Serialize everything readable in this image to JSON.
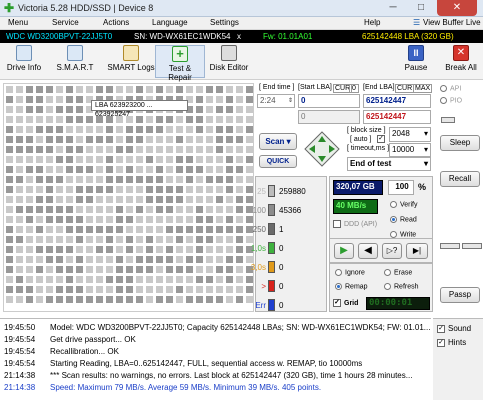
{
  "window": {
    "title": "Victoria 5.28 HDD/SSD | Device 8",
    "min": "─",
    "max": "□",
    "close": "✕"
  },
  "menu": {
    "items": [
      "Menu",
      "Service",
      "Actions",
      "Language",
      "Settings",
      "Help"
    ],
    "view_buffer": "View Buffer Live"
  },
  "device": {
    "model": "WDC WD3200BPVT-22JJ5T0",
    "serial": "SN: WD-WX61EC1WDK54",
    "x": "x",
    "firmware": "Fw: 01.01A01",
    "capacity": "625142448 LBA (320 GB)"
  },
  "toolbar": {
    "drive_info": "Drive Info",
    "smart": "S.M.A.R.T",
    "smart_logs": "SMART Logs",
    "test_repair": "Test & Repair",
    "disk_editor": "Disk Editor",
    "pause": "Pause",
    "break_all": "Break All"
  },
  "grid": {
    "tooltip": "LBA 623923200 ... 623925247"
  },
  "range": {
    "end_time_label": "[ End time ]",
    "start_lba_label": "[Start LBA]",
    "cur_label": "CUR",
    "zero_label": "0",
    "end_lba_label": "[End LBA]",
    "cur2_label": "CUR",
    "max_label": "MAX",
    "end_time": "2:24",
    "start_lba": "0",
    "end_lba": "625142447",
    "start_lba2": "0",
    "end_lba2": "625142447"
  },
  "scan": {
    "scan_button": "Scan",
    "quick_button": "QUICK",
    "block_size_label": "[ block size ]",
    "auto_label": "[ auto ]",
    "block_size": "2048",
    "timeout_label": "[ timeout,ms ]",
    "timeout": "10000",
    "end_mode": "End of test"
  },
  "legend": {
    "rows": [
      {
        "threshold": "25",
        "count": "259880",
        "color": "#bcbcbc"
      },
      {
        "threshold": "100",
        "count": "45366",
        "color": "#8c8c8c"
      },
      {
        "threshold": "250",
        "count": "1",
        "color": "#6a6a6a"
      },
      {
        "threshold": "1,0s",
        "count": "0",
        "color": "#3fb23f"
      },
      {
        "threshold": "3,0s",
        "count": "0",
        "color": "#e09a1a"
      },
      {
        "threshold": ">",
        "count": "0",
        "color": "#d8231c"
      },
      {
        "threshold": "Err",
        "count": "0",
        "color": "#1f3fcf"
      }
    ]
  },
  "stats": {
    "size": "320,07 GB",
    "percent": "100",
    "percent_unit": "%",
    "speed": "40 MB/s",
    "ddd": "DDD (API)",
    "verify": "Verify",
    "read": "Read",
    "write": "Write"
  },
  "actions": {
    "ignore": "Ignore",
    "erase": "Erase",
    "remap": "Remap",
    "refresh": "Refresh",
    "grid": "Grid",
    "timer": "00:00:01"
  },
  "side": {
    "api": "API",
    "pio": "PIO",
    "sleep": "Sleep",
    "recall": "Recall",
    "passp": "Passp"
  },
  "log": {
    "rows": [
      {
        "time": "19:45:50",
        "text": "Model: WDC WD3200BPVT-22JJ5T0; Capacity 625142448 LBAs; SN: WD-WX61EC1WDK54; FW: 01.01...",
        "color": "#000000"
      },
      {
        "time": "19:45:54",
        "text": "Get drive passport... OK",
        "color": "#000000"
      },
      {
        "time": "19:45:54",
        "text": "Recallibration... OK",
        "color": "#000000"
      },
      {
        "time": "19:45:54",
        "text": "Starting Reading, LBA=0..625142447, FULL, sequential access w. REMAP, tio 10000ms",
        "color": "#000000"
      },
      {
        "time": "21:14:38",
        "text": "*** Scan results: no warnings, no errors. Last block at 625142447 (320 GB), time 1 hours 28 minutes...",
        "color": "#000000"
      },
      {
        "time": "21:14:38",
        "text": "Speed: Maximum 79 MB/s. Average 59 MB/s. Minimum 39 MB/s. 405 points.",
        "color": "#1a3ec8"
      }
    ]
  },
  "options": {
    "sound": "Sound",
    "hints": "Hints"
  }
}
